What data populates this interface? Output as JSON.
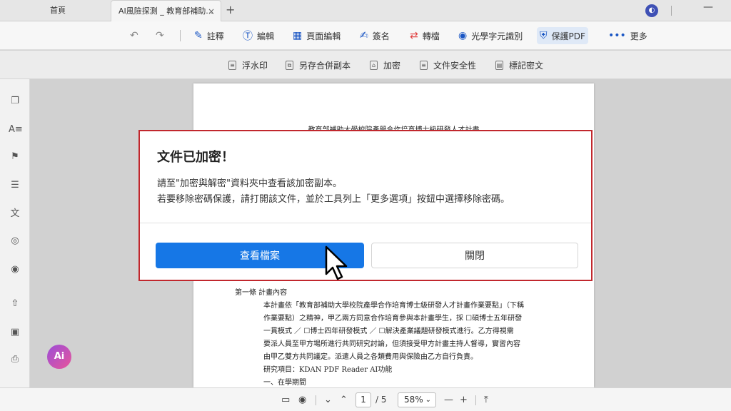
{
  "tabs": {
    "home_label": "首頁",
    "active_label": "AI風險探測 _ 教育部補助...",
    "close_glyph": "×",
    "new_tab_glyph": "+"
  },
  "toolbar": {
    "undo_icon": "↶",
    "redo_icon": "↷",
    "annotate": "註釋",
    "edit": "編輯",
    "page_edit": "頁面編輯",
    "sign": "簽名",
    "convert": "轉檔",
    "ocr": "光學字元識別",
    "protect": "保護PDF",
    "more": "更多"
  },
  "subtoolbar": {
    "watermark": "浮水印",
    "save_merged_copy": "另存合併副本",
    "encrypt": "加密",
    "doc_security": "文件安全性",
    "redact": "標記密文"
  },
  "document": {
    "title": "教育部補助大學校院產學合作培育博士級研發人才計畫",
    "lines": [
      "第一條  計畫內容",
      "本計畫依「教育部補助大學校院產學合作培育博士級研發人才計畫作業要點」（下稱",
      "作業要點）之精神，甲乙兩方同意合作培育參與本計畫學生，採 ☐碩博士五年研發",
      "一貫模式 ／ ☐博士四年研發模式 ／ ☐解決產業議題研發模式進行。乙方得視需",
      "要派人員至甲方場所進行共同研究討論，但須接受甲方計畫主持人督導，實習內容",
      "由甲乙雙方共同議定。派遣人員之各類費用與保險由乙方自行負責。",
      "研究項目：KDAN PDF Reader AI功能",
      "一、在學期間"
    ]
  },
  "dialog": {
    "title": "文件已加密！",
    "message_line1": "請至\"加密與解密\"資料夾中查看該加密副本。",
    "message_line2": "若要移除密碼保護，請打開該文件，並於工具列上「更多選項」按鈕中選擇移除密碼。",
    "view_button": "查看檔案",
    "close_button": "關閉"
  },
  "ai_button_label": "Ai",
  "bottombar": {
    "current_page": "1",
    "total_pages": "/ 5",
    "zoom": "58%"
  }
}
